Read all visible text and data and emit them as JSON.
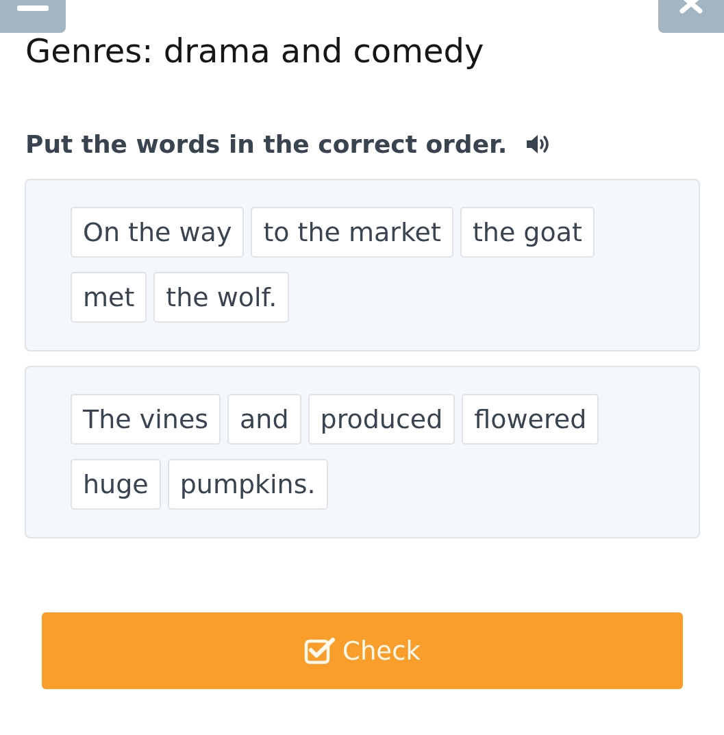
{
  "title": "Genres: drama and comedy",
  "instruction": "Put the words in the correct order.",
  "exercises": [
    {
      "chips": [
        "On the way",
        "to the market",
        "the goat",
        "met",
        "the wolf."
      ]
    },
    {
      "chips": [
        "The vines",
        "and",
        "produced",
        "flowered",
        "huge",
        "pumpkins."
      ]
    }
  ],
  "check_button": {
    "label": "Check"
  }
}
